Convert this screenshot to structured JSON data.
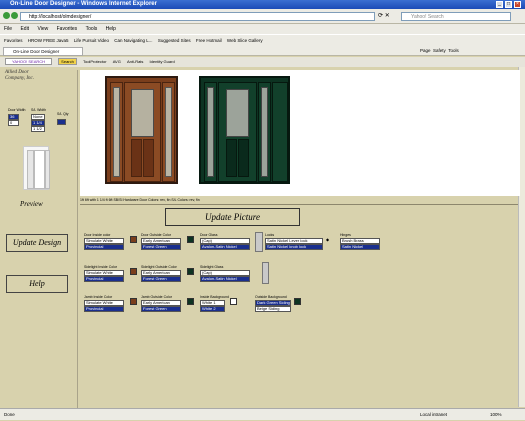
{
  "window": {
    "title": "On-Line Door Designer - Windows Internet Explorer"
  },
  "address": {
    "url": "http://localhost/olmdesigner/"
  },
  "search": {
    "placeholder": "Yahoo! Search"
  },
  "menu": [
    "File",
    "Edit",
    "View",
    "Favorites",
    "Tools",
    "Help"
  ],
  "favorites": [
    "Favorites",
    "HROW FREE Java5",
    "Life Pursuit Video",
    "Can Navigating L...",
    "Suggested Sites",
    "Free Hotmail",
    "Web Slice Gallery"
  ],
  "tab": {
    "label": "On-Line Door Designer"
  },
  "toolbar2": [
    "YAHOO! SEARCH",
    "Search",
    "ToolProtector",
    "AVG",
    "Anti-Rats",
    "Identity Guard"
  ],
  "cmdbar": [
    "Page",
    "Safety",
    "Tools"
  ],
  "left": {
    "logo": [
      "Allied Door Company, Inc."
    ],
    "door_width_label": "Door Width",
    "sl_width_label": "S/L Width",
    "sl_qty_label": "S/L Qty",
    "door_width_values": [
      "36",
      "0"
    ],
    "sl_width_values": [
      "None",
      "1 1/4",
      "1 1/2"
    ],
    "preview_label": "Preview",
    "update_design": "Update Design",
    "help": "Help"
  },
  "caption": "1ft 6ft with 1 1/4 ft 6ft  SB/SI Hardware  Door Colors: rev, fin  S/L Colors: rev, fin",
  "update_picture": "Update Picture",
  "controls": {
    "door_inside": {
      "label": "Door Inside color",
      "v1": "Simulate White",
      "v2": "Provincial"
    },
    "door_outside": {
      "label": "Door Outside Color",
      "v1": "Early American",
      "v2": "Forest Green"
    },
    "door_glass": {
      "label": "Door Glass",
      "v1": "(Cap)",
      "v2": "Avalon-Satin Nickel"
    },
    "locks": {
      "label": "Locks",
      "v1": "Satin Nickel Lever lock",
      "v2": "Satin Nickel knob lock"
    },
    "hinges": {
      "label": "Hinges",
      "v1": "Brush Brass",
      "v2": "Satin Nickel"
    },
    "sl_inside": {
      "label": "Sidelight Inside Color",
      "v1": "Simulate White",
      "v2": "Provincial"
    },
    "sl_outside": {
      "label": "Sidelight Outside Color",
      "v1": "Early American",
      "v2": "Forest Green"
    },
    "sl_glass": {
      "label": "Sidelight Glass",
      "v1": "(Cap)",
      "v2": "Avalon-Satin Nickel"
    },
    "jamb_inside": {
      "label": "Jamb Inside Color",
      "v1": "Simulate White",
      "v2": "Provincial"
    },
    "jamb_outside": {
      "label": "Jamb Outside Color",
      "v1": "Early American",
      "v2": "Forest Green"
    },
    "inside_bg": {
      "label": "Inside Background",
      "v1": "White 1",
      "v2": "White 2"
    },
    "outside_bg": {
      "label": "Outside Background",
      "v1": "Dark Green Siding",
      "v2": "Beige Siding"
    }
  },
  "status": {
    "left": "Done",
    "zone": "Local intranet",
    "zoom": "100%"
  },
  "colors": {
    "brown": "#7a3e1c",
    "green": "#0d3322",
    "titlebar": "#2a5bc6"
  }
}
